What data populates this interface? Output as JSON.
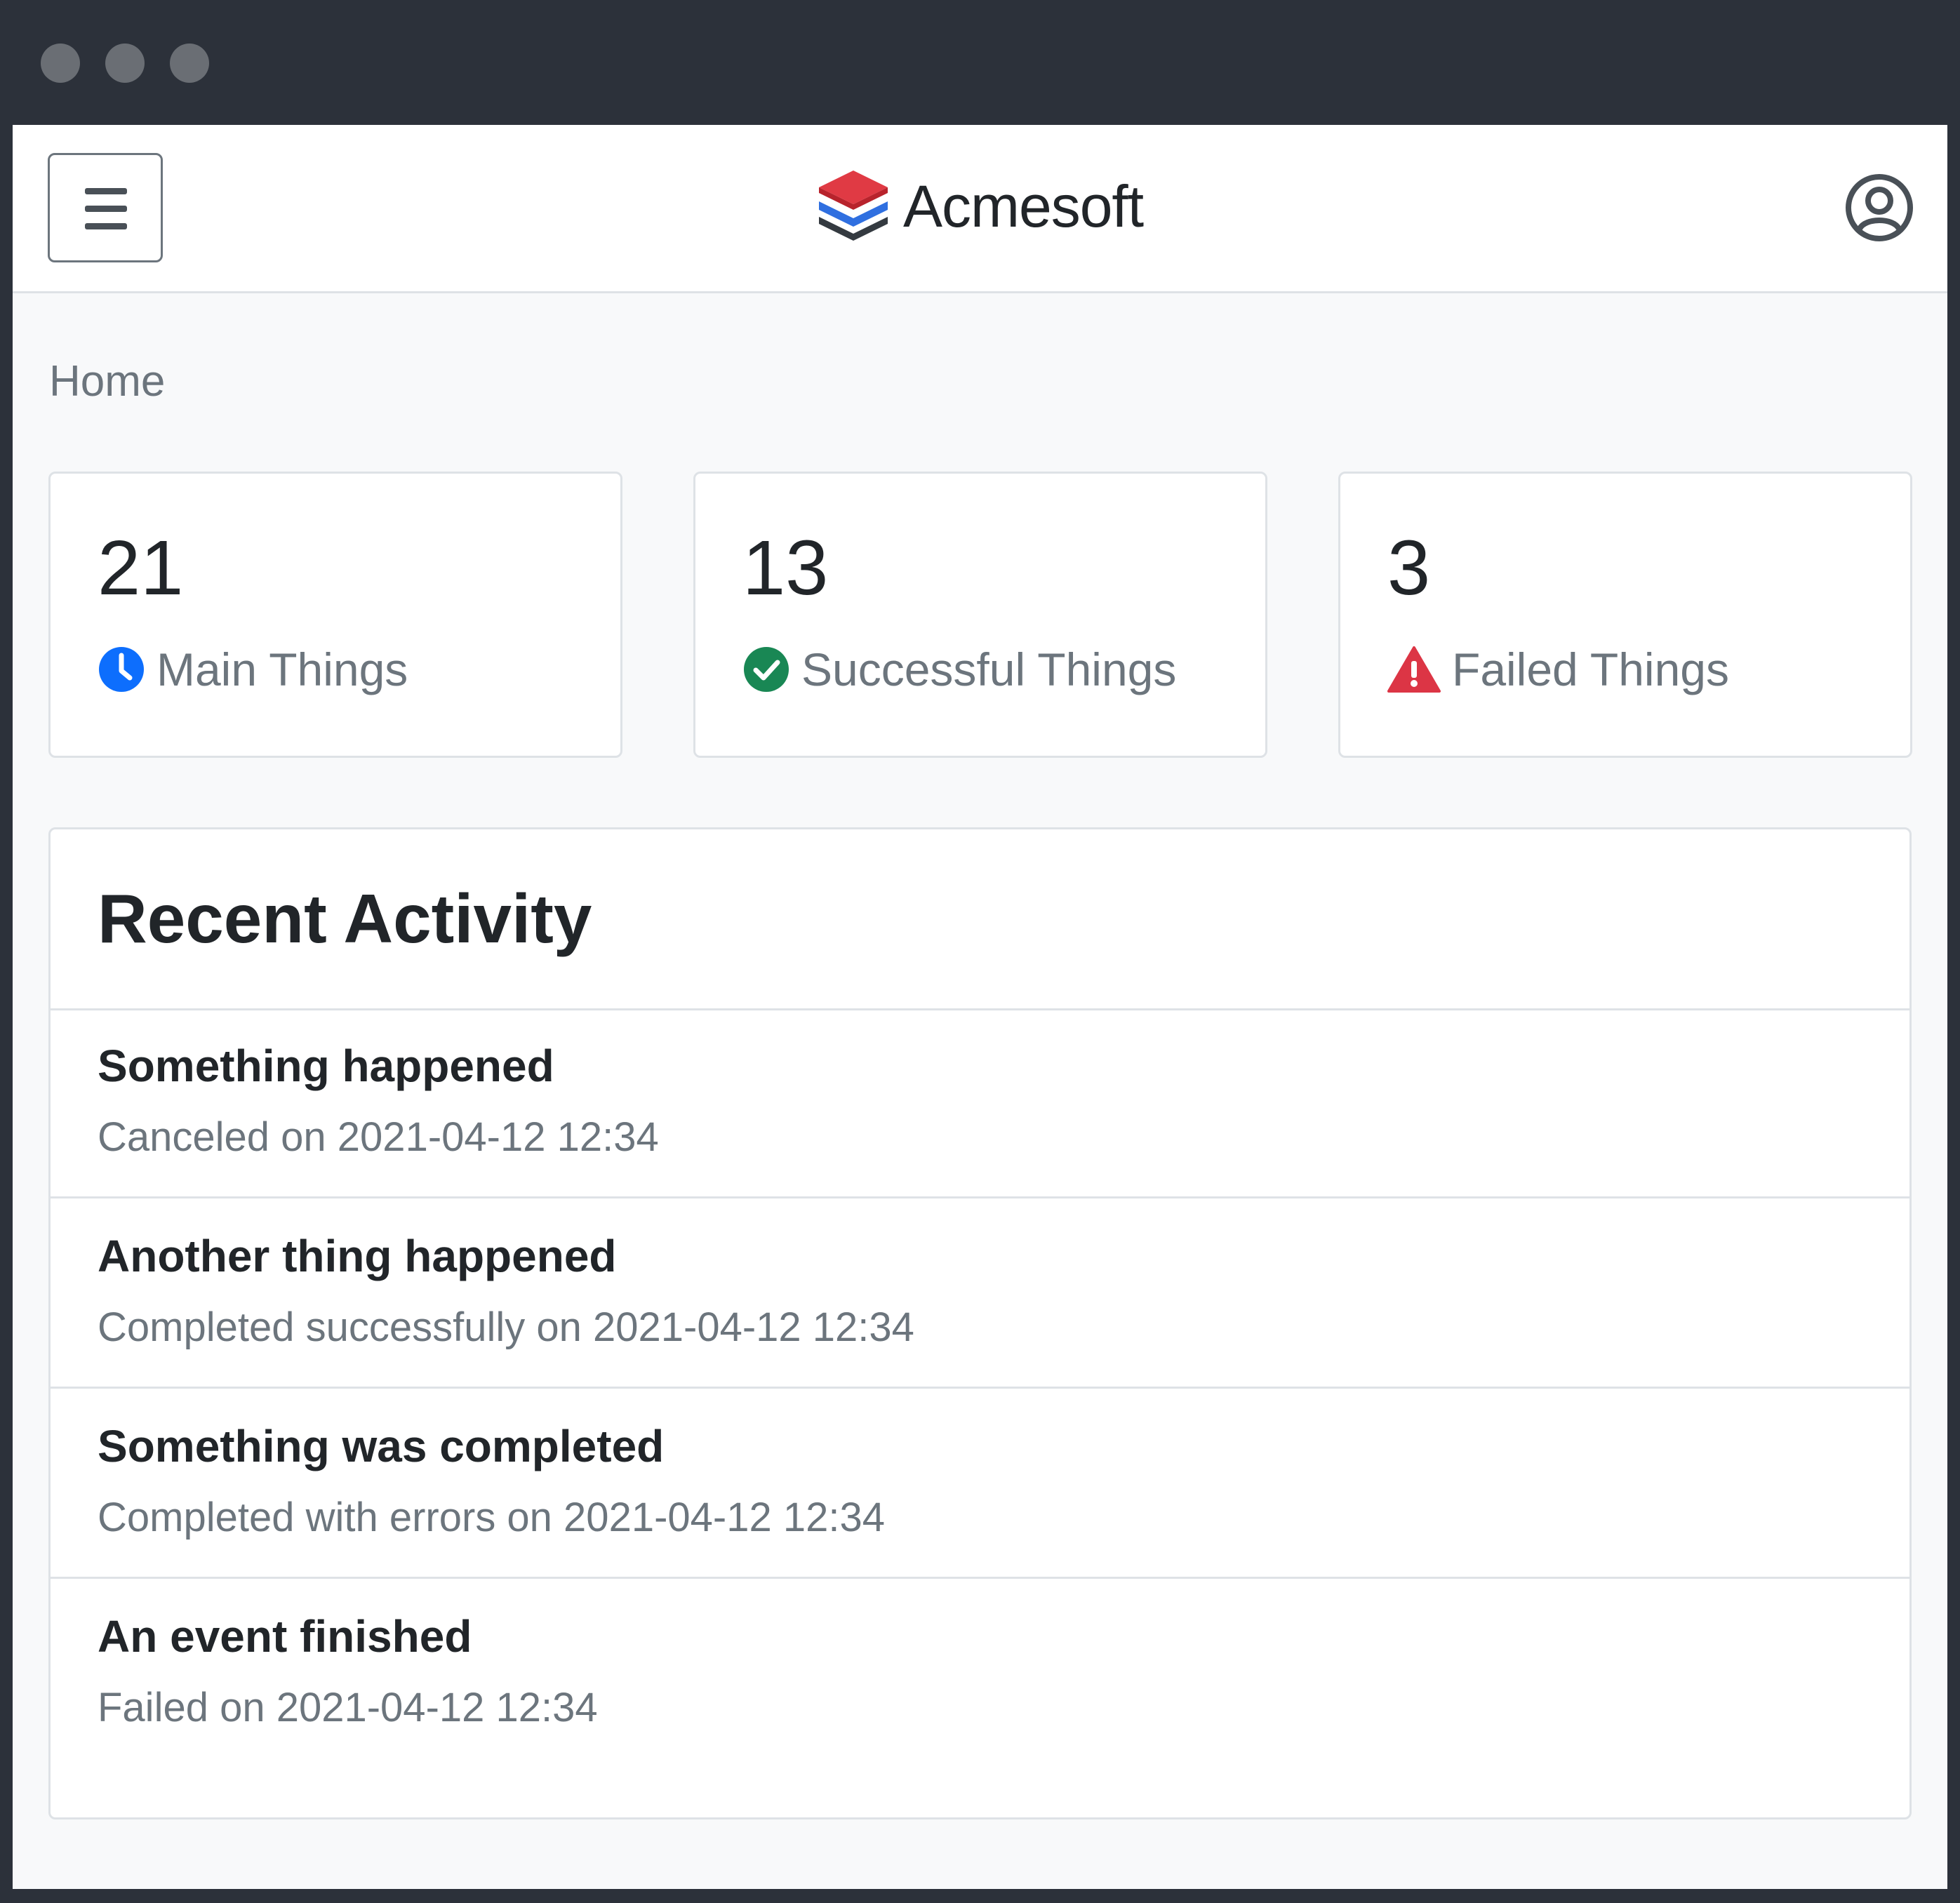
{
  "header": {
    "menu_icon": "hamburger-menu-icon",
    "brand_name": "Acmesoft",
    "brand_colors": [
      "#e03a44",
      "#2f6fe0",
      "#343a40"
    ],
    "user_icon": "user-circle-icon"
  },
  "breadcrumb": {
    "current": "Home"
  },
  "stats": [
    {
      "value": "21",
      "label": "Main Things",
      "icon": "clock-icon",
      "color": "#0d6efd"
    },
    {
      "value": "13",
      "label": "Successful Things",
      "icon": "check-circle-icon",
      "color": "#198754"
    },
    {
      "value": "3",
      "label": "Failed Things",
      "icon": "warning-triangle-icon",
      "color": "#dc3545"
    }
  ],
  "activity": {
    "title": "Recent Activity",
    "items": [
      {
        "title": "Something happened",
        "status": "Canceled on 2021-04-12 12:34"
      },
      {
        "title": "Another thing happened",
        "status": "Completed successfully on 2021-04-12 12:34"
      },
      {
        "title": "Something was completed",
        "status": "Completed with errors on 2021-04-12 12:34"
      },
      {
        "title": "An event finished",
        "status": "Failed on 2021-04-12 12:34"
      }
    ]
  }
}
